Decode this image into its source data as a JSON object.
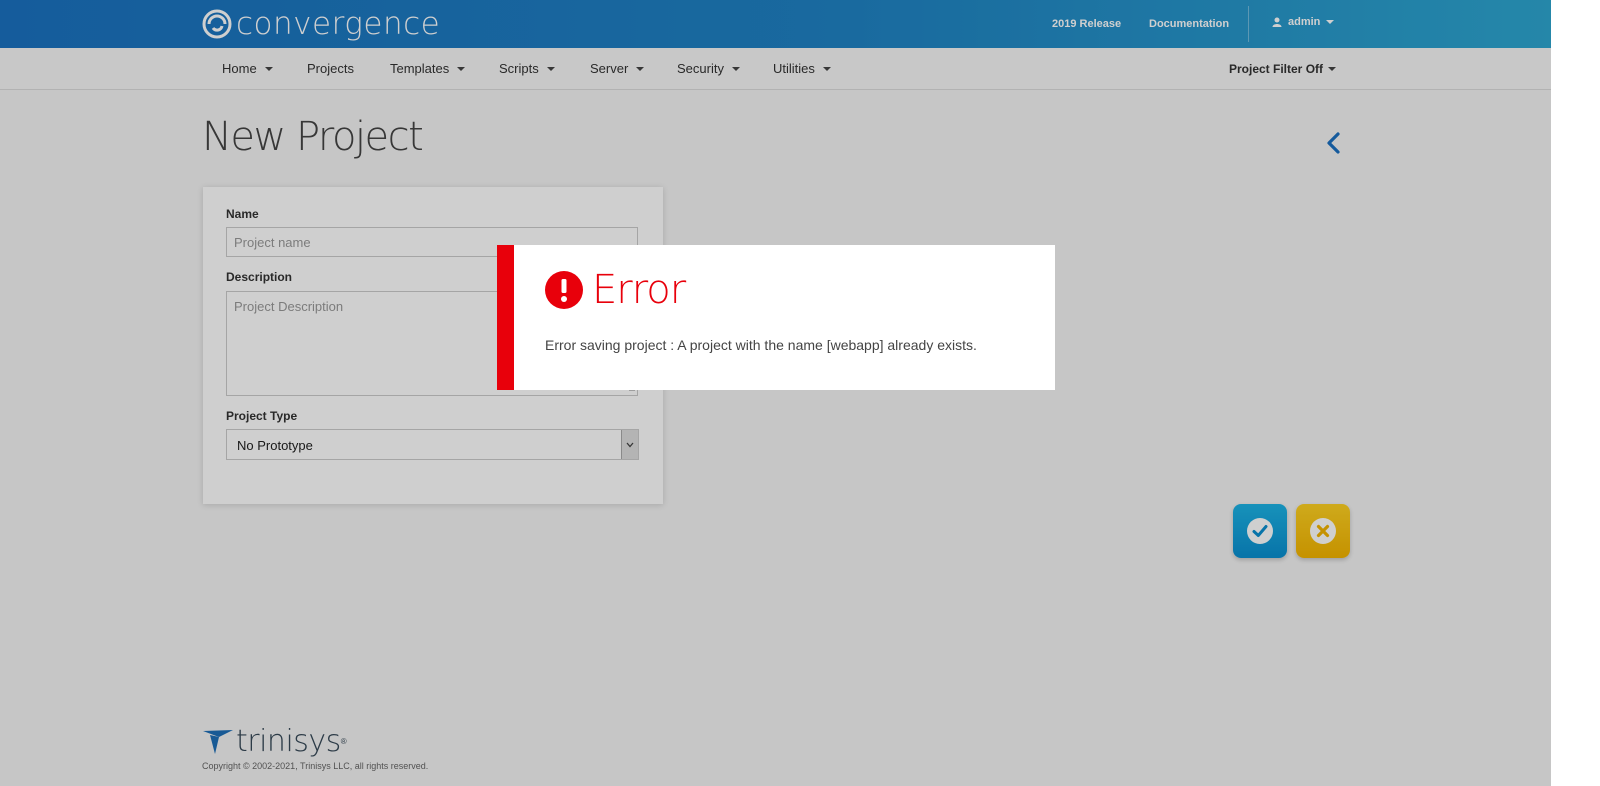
{
  "brand": {
    "name": "convergence"
  },
  "header": {
    "links": [
      "2019 Release",
      "Documentation"
    ],
    "user": "admin"
  },
  "nav": {
    "items": [
      {
        "label": "Home",
        "dropdown": true
      },
      {
        "label": "Projects",
        "dropdown": false
      },
      {
        "label": "Templates",
        "dropdown": true
      },
      {
        "label": "Scripts",
        "dropdown": true
      },
      {
        "label": "Server",
        "dropdown": true
      },
      {
        "label": "Security",
        "dropdown": true
      },
      {
        "label": "Utilities",
        "dropdown": true
      }
    ],
    "filter": "Project Filter Off"
  },
  "page": {
    "title": "New Project"
  },
  "form": {
    "name_label": "Name",
    "name_placeholder": "Project name",
    "name_value": "",
    "description_label": "Description",
    "description_placeholder": "Project Description",
    "description_value": "",
    "type_label": "Project Type",
    "type_value": "No Prototype"
  },
  "actions": {
    "save_icon": "check-circle-icon",
    "cancel_icon": "times-circle-icon"
  },
  "footer": {
    "logo_text": "trinisys",
    "copyright": "Copyright © 2002-2021, Trinisys LLC, all rights reserved."
  },
  "modal": {
    "title": "Error",
    "message": "Error saving project : A project with the name [webapp] already exists.",
    "icon": "exclamation-circle-icon"
  },
  "colors": {
    "header_start": "#1b72c0",
    "header_end": "#2ea7d1",
    "error": "#e8000b",
    "back_arrow": "#1a6fc1",
    "save_button": "#0a8fd0",
    "cancel_button": "#f3b400"
  }
}
